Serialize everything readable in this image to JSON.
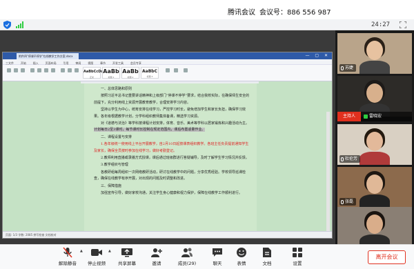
{
  "top": {
    "app_name": "腾讯会议",
    "meeting_id_label": "会议号：",
    "meeting_id": "886 556 987"
  },
  "status": {
    "timer": "24:27"
  },
  "document": {
    "tab_title": "附件四\"停课不停学\"在线教学工作方案.docx",
    "menu": [
      "三文件",
      "开始",
      "插入",
      "页面布局",
      "引用",
      "审阅",
      "视图",
      "章节",
      "开发工具",
      "会员专享"
    ],
    "styles": [
      {
        "sample": "AaBbCcDd",
        "caption": "正文"
      },
      {
        "sample": "AaBb",
        "caption": "标题 1"
      },
      {
        "sample": "AaBb",
        "caption": "标题 2"
      },
      {
        "sample": "AaBbC",
        "caption": "标题 3"
      }
    ],
    "status_text": "页面: 1/3   字数: 2085   拼写检查   文档校对"
  },
  "participants": [
    {
      "name": "苏婕",
      "bg": "#b9a48a",
      "skin": "#e7c2a0",
      "hair": "#2b2118",
      "shirt": "#444"
    },
    {
      "name": "雷晓宏",
      "bg": "#2d2b28",
      "skin": "#d8b08c",
      "hair": "#1d1a18",
      "shirt": "#333"
    },
    {
      "name": "杜伦芳",
      "bg": "#d9d0c3",
      "skin": "#e3b99a",
      "hair": "#23190f",
      "shirt": "#b03a3a"
    },
    {
      "name": "张磊",
      "bg": "#8c6a4c",
      "skin": "#e0b897",
      "hair": "#1e1712",
      "shirt": "#222"
    },
    {
      "name": "",
      "bg": "#8a7f74",
      "skin": "#d9ad8a",
      "hair": "#1a1410",
      "shirt": "#2a2a2a"
    }
  ],
  "host": {
    "badge": "主持人",
    "name": "雷晓宏"
  },
  "toolbar": {
    "unmute": "解除静音",
    "stop_video": "停止视频",
    "share_screen": "共享屏幕",
    "invite": "邀请",
    "members": "成员(29)",
    "chat": "聊天",
    "reactions": "表情",
    "documents": "文档",
    "settings": "设置",
    "leave": "离开会议"
  },
  "colors": {
    "accent_red": "#e0301e",
    "doc_green": "#c5e2c5",
    "signal_green": "#2ecc40"
  }
}
